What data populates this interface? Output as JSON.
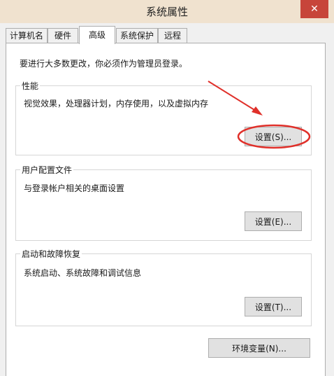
{
  "window": {
    "title": "系统属性",
    "close_glyph": "✕"
  },
  "tabs": [
    {
      "label": "计算机名"
    },
    {
      "label": "硬件"
    },
    {
      "label": "高级",
      "active": true
    },
    {
      "label": "系统保护"
    },
    {
      "label": "远程"
    }
  ],
  "advanced": {
    "admin_note": "要进行大多数更改，你必须作为管理员登录。",
    "performance": {
      "title": "性能",
      "description": "视觉效果，处理器计划，内存使用，以及虚拟内存",
      "button": "设置(S)..."
    },
    "user_profiles": {
      "title": "用户配置文件",
      "description": "与登录帐户相关的桌面设置",
      "button": "设置(E)..."
    },
    "startup_recovery": {
      "title": "启动和故障恢复",
      "description": "系统启动、系统故障和调试信息",
      "button": "设置(T)..."
    },
    "env_button": "环境变量(N)..."
  },
  "colors": {
    "titlebar": "#f0e2cf",
    "close_button": "#c7453a",
    "annotation_red": "#e0302a"
  }
}
